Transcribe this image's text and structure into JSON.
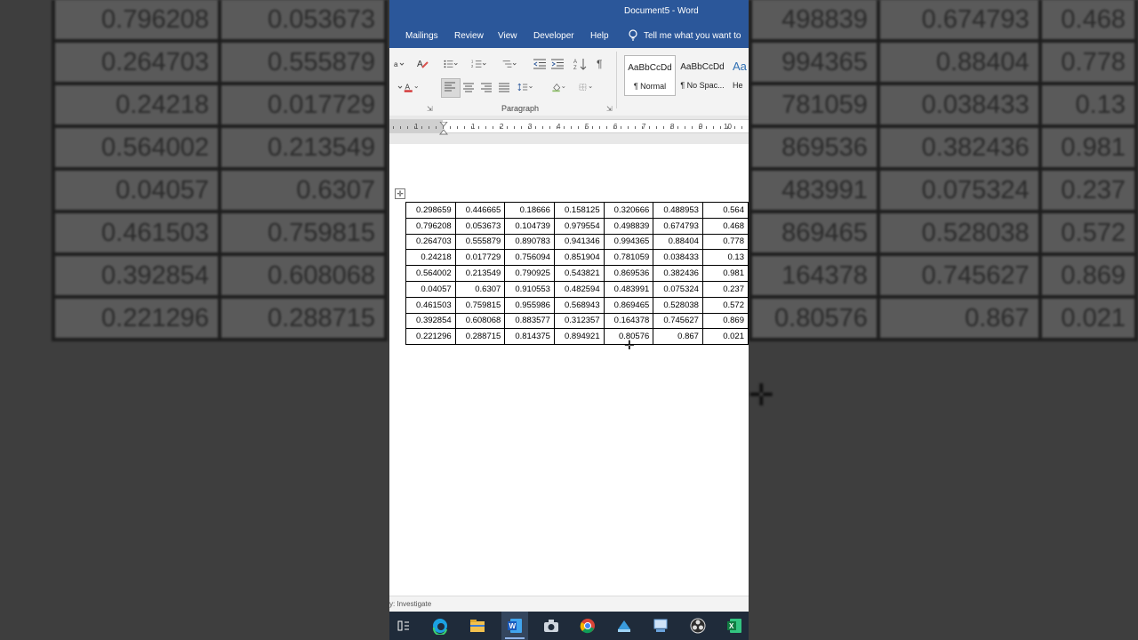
{
  "window": {
    "title": "Document5 - Word"
  },
  "tabs": [
    {
      "label": "Mailings"
    },
    {
      "label": "Review"
    },
    {
      "label": "View"
    },
    {
      "label": "Developer"
    },
    {
      "label": "Help"
    }
  ],
  "tell_me": {
    "text": "Tell me what you want to"
  },
  "ribbon": {
    "paragraph_label": "Paragraph",
    "styles": [
      {
        "sample": "AaBbCcDd",
        "name": "¶ Normal"
      },
      {
        "sample": "AaBbCcDd",
        "name": "¶ No Spac..."
      },
      {
        "sample": "Aa",
        "name": "He"
      }
    ]
  },
  "ruler": {
    "numbers": [
      "1",
      "1",
      "2",
      "3",
      "4",
      "5",
      "6",
      "7",
      "8",
      "9",
      "10"
    ]
  },
  "table": {
    "rows": [
      [
        "0.298659",
        "0.446665",
        "0.18666",
        "0.158125",
        "0.320666",
        "0.488953",
        "0.564"
      ],
      [
        "0.796208",
        "0.053673",
        "0.104739",
        "0.979554",
        "0.498839",
        "0.674793",
        "0.468"
      ],
      [
        "0.264703",
        "0.555879",
        "0.890783",
        "0.941346",
        "0.994365",
        "0.88404",
        "0.778"
      ],
      [
        "0.24218",
        "0.017729",
        "0.756094",
        "0.851904",
        "0.781059",
        "0.038433",
        "0.13"
      ],
      [
        "0.564002",
        "0.213549",
        "0.790925",
        "0.543821",
        "0.869536",
        "0.382436",
        "0.981"
      ],
      [
        "0.04057",
        "0.6307",
        "0.910553",
        "0.482594",
        "0.483991",
        "0.075324",
        "0.237"
      ],
      [
        "0.461503",
        "0.759815",
        "0.955986",
        "0.568943",
        "0.869465",
        "0.528038",
        "0.572"
      ],
      [
        "0.392854",
        "0.608068",
        "0.883577",
        "0.312357",
        "0.164378",
        "0.745627",
        "0.869"
      ],
      [
        "0.221296",
        "0.288715",
        "0.814375",
        "0.894921",
        "0.80576",
        "0.867",
        "0.021"
      ]
    ]
  },
  "background": {
    "left_rows": [
      [
        "0.796208",
        "0.053673"
      ],
      [
        "0.264703",
        "0.555879"
      ],
      [
        "0.24218",
        "0.017729"
      ],
      [
        "0.564002",
        "0.213549"
      ],
      [
        "0.04057",
        "0.6307"
      ],
      [
        "0.461503",
        "0.759815"
      ],
      [
        "0.392854",
        "0.608068"
      ],
      [
        "0.221296",
        "0.288715"
      ]
    ],
    "right_rows": [
      [
        "498839",
        "0.674793",
        "0.468"
      ],
      [
        "994365",
        "0.88404",
        "0.778"
      ],
      [
        "781059",
        "0.038433",
        "0.13"
      ],
      [
        "869536",
        "0.382436",
        "0.981"
      ],
      [
        "483991",
        "0.075324",
        "0.237"
      ],
      [
        "869465",
        "0.528038",
        "0.572"
      ],
      [
        "164378",
        "0.745627",
        "0.869"
      ],
      [
        "0.80576",
        "0.867",
        "0.021"
      ]
    ]
  },
  "status": {
    "text": "y: Investigate"
  },
  "colors": {
    "word_blue": "#2b579a",
    "taskbar": "#1f2b3a"
  }
}
